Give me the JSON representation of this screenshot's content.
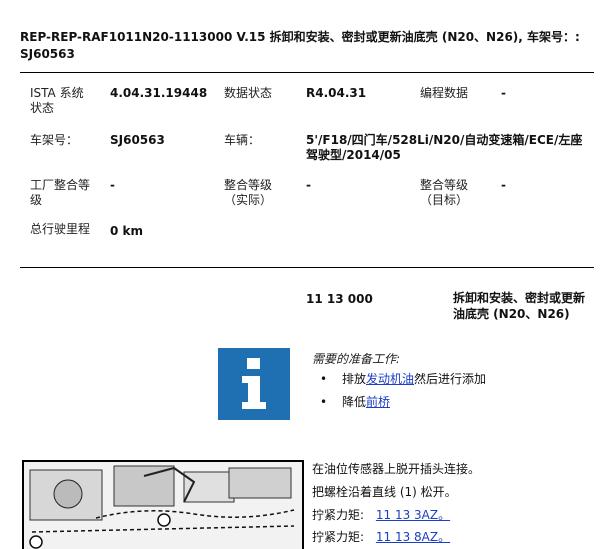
{
  "document": {
    "title": "REP-REP-RAF1011N20-1113000   V.15   拆卸和安装、密封或更新油底壳 (N20、N26), 车架号：: SJ60563"
  },
  "info_table": {
    "ista_label": "ISTA 系统状态",
    "ista_value": "4.04.31.19448",
    "data_status_label": "数据状态",
    "data_status_value": "R4.04.31",
    "programming_label": "编程数据",
    "programming_value": "-",
    "vin_label": "车架号：",
    "vin_value": "SJ60563",
    "vehicle_label": "车辆：",
    "vehicle_value": "5'/F18/四门车/528Li/N20/自动变速箱/ECE/左座驾驶型/2014/05",
    "factory_label": "工厂整合等级",
    "factory_value": "-",
    "actual_label": "整合等级（实际）",
    "actual_value": "-",
    "target_label": "整合等级（目标）",
    "target_value": "-",
    "mileage_label": "总行驶里程",
    "mileage_value": "0 km"
  },
  "operation": {
    "code": "11 13 000",
    "name": "拆卸和安装、密封或更新油底壳 (N20、N26)"
  },
  "preparation": {
    "heading": "需要的准备工作:",
    "item1_before": "排放",
    "item1_link": "发动机油",
    "item1_after": "然后进行添加",
    "item2_before": "降低",
    "item2_link": "前桥"
  },
  "steps": {
    "line1": "在油位传感器上脱开插头连接。",
    "line2": "把螺栓沿着直线 (1) 松开。",
    "torque1_label": "拧紧力矩:",
    "torque1_link": "11 13 3AZ。",
    "torque2_label": "拧紧力矩:",
    "torque2_link": "11 13 8AZ。"
  },
  "icons": {
    "info": "info-icon",
    "bullet": "bullet-icon"
  },
  "colors": {
    "info_box": "#1f6fb3",
    "link": "#1a3ec4"
  }
}
